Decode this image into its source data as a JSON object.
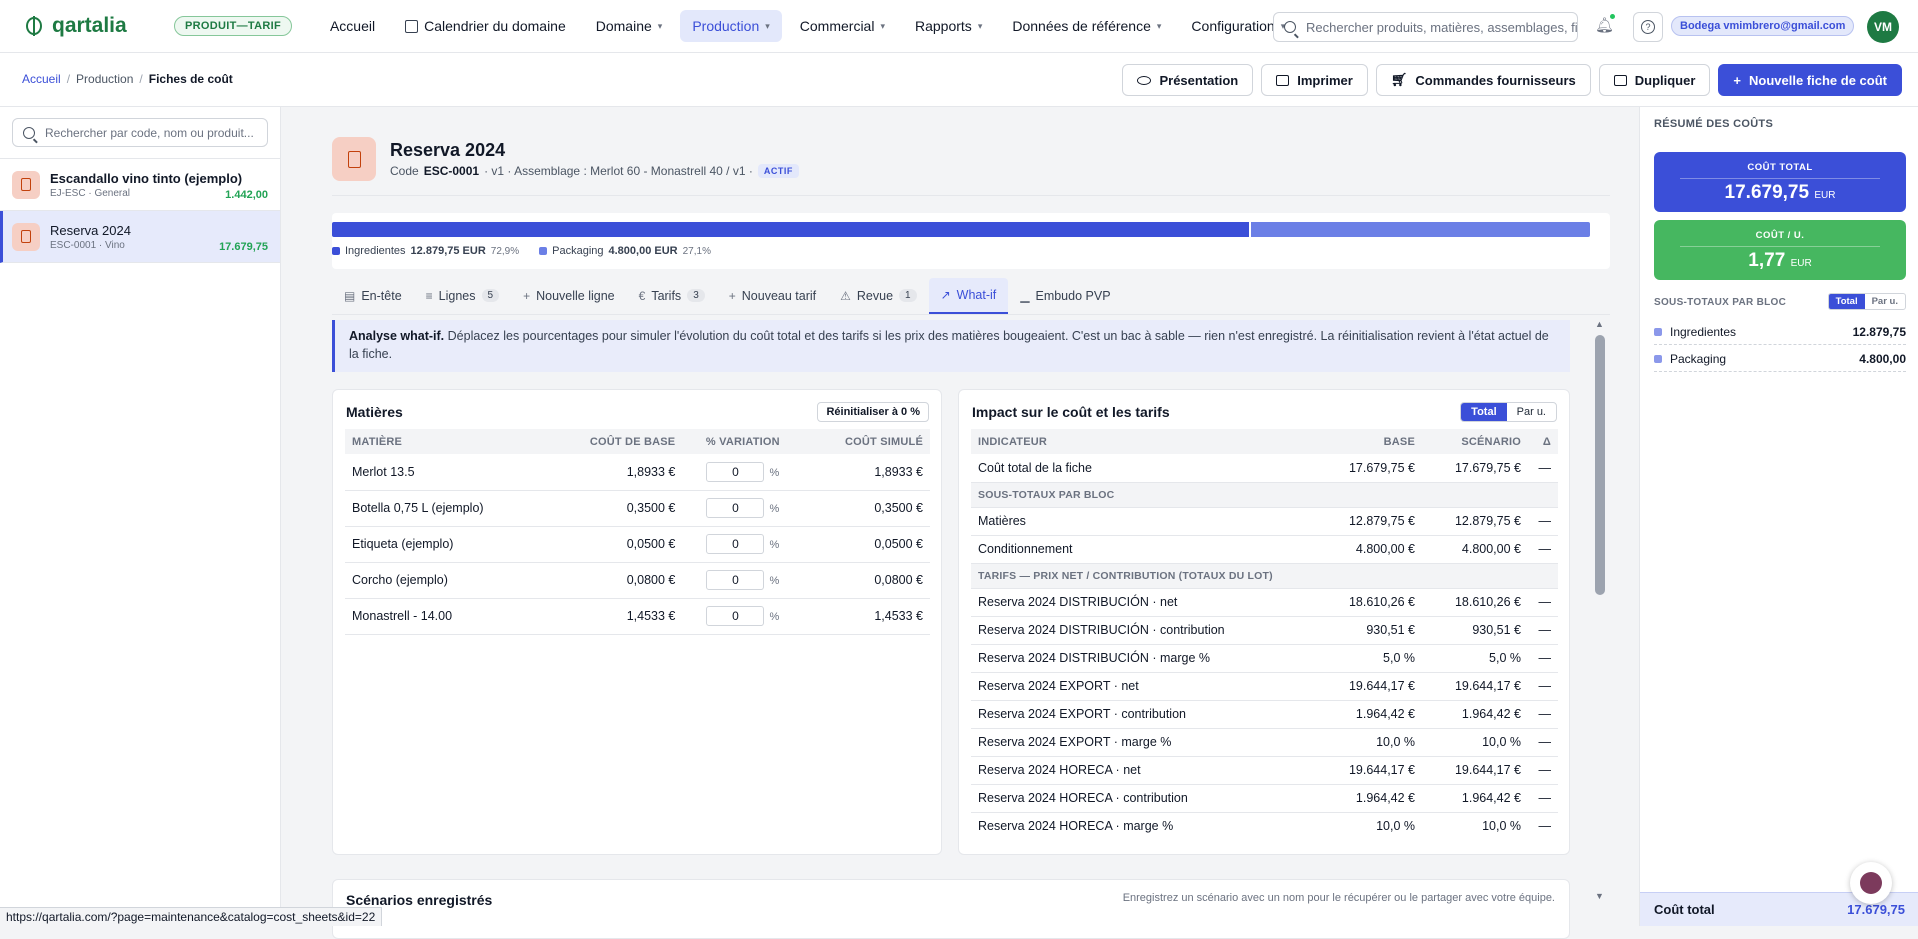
{
  "topbar": {
    "logo": "qartalia",
    "plan_badge": "PRODUIT—TARIF",
    "nav": [
      {
        "label": "Accueil"
      },
      {
        "label": "Calendrier du domaine"
      },
      {
        "label": "Domaine"
      },
      {
        "label": "Production"
      },
      {
        "label": "Commercial"
      },
      {
        "label": "Rapports"
      },
      {
        "label": "Données de référence"
      },
      {
        "label": "Configuration"
      }
    ],
    "search_placeholder": "Rechercher produits, matières, assemblages, fiches…",
    "user_chip": "Bodega vmimbrero@gmail.com",
    "avatar": "VM"
  },
  "breadcrumb": {
    "home": "Accueil",
    "section": "Production",
    "current": "Fiches de coût"
  },
  "actions": {
    "presentation": "Présentation",
    "print": "Imprimer",
    "supplier_orders": "Commandes fournisseurs",
    "duplicate": "Dupliquer",
    "new_sheet": "Nouvelle fiche de coût"
  },
  "sidebar": {
    "search_placeholder": "Rechercher par code, nom ou produit...",
    "items": [
      {
        "name": "Escandallo vino tinto (ejemplo)",
        "sub": "EJ-ESC · General",
        "value": "1.442,00"
      },
      {
        "name": "Reserva 2024",
        "sub": "ESC-0001 · Vino",
        "value": "17.679,75"
      }
    ]
  },
  "sheet": {
    "title": "Reserva 2024",
    "code_label": "Code",
    "code": "ESC-0001",
    "meta": "· v1 · Assemblage : Merlot 60 - Monastrell 40 / v1 ·",
    "status": "ACTIF"
  },
  "cost_bar": {
    "segments": [
      {
        "label": "Ingredientes",
        "amount": "12.879,75 EUR",
        "pct_label": "72,9%",
        "fraction": 0.729,
        "color": "#3b4fd8"
      },
      {
        "label": "Packaging",
        "amount": "4.800,00 EUR",
        "pct_label": "27,1%",
        "fraction": 0.271,
        "color": "#6b7fe6"
      }
    ]
  },
  "tabs": [
    {
      "label": "En-tête",
      "glyph": "▤"
    },
    {
      "label": "Lignes",
      "glyph": "≡",
      "count": "5"
    },
    {
      "label": "Nouvelle ligne",
      "glyph": "+"
    },
    {
      "label": "Tarifs",
      "glyph": "€",
      "count": "3"
    },
    {
      "label": "Nouveau tarif",
      "glyph": "+"
    },
    {
      "label": "Revue",
      "glyph": "⚠",
      "count": "1"
    },
    {
      "label": "What-if",
      "glyph": "↗"
    },
    {
      "label": "Embudo PVP",
      "glyph": "▁"
    }
  ],
  "info": {
    "bold": "Analyse what-if.",
    "text": " Déplacez les pourcentages pour simuler l'évolution du coût total et des tarifs si les prix des matières bougeaient. C'est un bac à sable — rien n'est enregistré. La réinitialisation revient à l'état actuel de la fiche."
  },
  "materials": {
    "title": "Matières",
    "reset": "Réinitialiser à 0 %",
    "headers": [
      "MATIÈRE",
      "COÛT DE BASE",
      "% VARIATION",
      "COÛT SIMULÉ"
    ],
    "pct_sign": "%",
    "rows": [
      {
        "name": "Merlot 13.5",
        "base": "1,8933 €",
        "variation": "0",
        "simulated": "1,8933 €"
      },
      {
        "name": "Botella 0,75 L (ejemplo)",
        "base": "0,3500 €",
        "variation": "0",
        "simulated": "0,3500 €"
      },
      {
        "name": "Etiqueta (ejemplo)",
        "base": "0,0500 €",
        "variation": "0",
        "simulated": "0,0500 €"
      },
      {
        "name": "Corcho (ejemplo)",
        "base": "0,0800 €",
        "variation": "0",
        "simulated": "0,0800 €"
      },
      {
        "name": "Monastrell - 14.00",
        "base": "1,4533 €",
        "variation": "0",
        "simulated": "1,4533 €"
      }
    ]
  },
  "impact": {
    "title": "Impact sur le coût et les tarifs",
    "toggle": [
      "Total",
      "Par u."
    ],
    "headers": [
      "INDICATEUR",
      "BASE",
      "SCÉNARIO",
      "Δ"
    ],
    "rows": [
      {
        "label": "Coût total de la fiche",
        "base": "17.679,75 €",
        "scenario": "17.679,75 €",
        "delta": "—"
      },
      {
        "section": "SOUS-TOTAUX PAR BLOC"
      },
      {
        "label": "Matières",
        "base": "12.879,75 €",
        "scenario": "12.879,75 €",
        "delta": "—"
      },
      {
        "label": "Conditionnement",
        "base": "4.800,00 €",
        "scenario": "4.800,00 €",
        "delta": "—"
      },
      {
        "section": "TARIFS — PRIX NET / CONTRIBUTION (TOTAUX DU LOT)"
      },
      {
        "label": "Reserva 2024 DISTRIBUCIÓN · net",
        "base": "18.610,26 €",
        "scenario": "18.610,26 €",
        "delta": "—"
      },
      {
        "label": "Reserva 2024 DISTRIBUCIÓN · contribution",
        "base": "930,51 €",
        "scenario": "930,51 €",
        "delta": "—"
      },
      {
        "label": "Reserva 2024 DISTRIBUCIÓN · marge %",
        "base": "5,0 %",
        "scenario": "5,0 %",
        "delta": "—"
      },
      {
        "label": "Reserva 2024 EXPORT · net",
        "base": "19.644,17 €",
        "scenario": "19.644,17 €",
        "delta": "—"
      },
      {
        "label": "Reserva 2024 EXPORT · contribution",
        "base": "1.964,42 €",
        "scenario": "1.964,42 €",
        "delta": "—"
      },
      {
        "label": "Reserva 2024 EXPORT · marge %",
        "base": "10,0 %",
        "scenario": "10,0 %",
        "delta": "—"
      },
      {
        "label": "Reserva 2024 HORECA · net",
        "base": "19.644,17 €",
        "scenario": "19.644,17 €",
        "delta": "—"
      },
      {
        "label": "Reserva 2024 HORECA · contribution",
        "base": "1.964,42 €",
        "scenario": "1.964,42 €",
        "delta": "—"
      },
      {
        "label": "Reserva 2024 HORECA · marge %",
        "base": "10,0 %",
        "scenario": "10,0 %",
        "delta": "—"
      }
    ]
  },
  "scenarios": {
    "title": "Scénarios enregistrés",
    "subtitle": "Enregistrez un scénario avec un nom pour le récupérer ou le partager avec votre équipe."
  },
  "summary": {
    "title": "RÉSUMÉ DES COÛTS",
    "total_label": "COÛT TOTAL",
    "total_value": "17.679,75",
    "unit_label": "COÛT / U.",
    "unit_value": "1,77",
    "currency": "EUR",
    "subtotals_label": "SOUS-TOTAUX PAR BLOC",
    "toggle": [
      "Total",
      "Par u."
    ],
    "subtotals": [
      {
        "label": "Ingredientes",
        "value": "12.879,75"
      },
      {
        "label": "Packaging",
        "value": "4.800,00"
      }
    ],
    "footer_label": "Coût total",
    "footer_value": "17.679,75"
  },
  "status_url": "https://qartalia.com/?page=maintenance&catalog=cost_sheets&id=22"
}
